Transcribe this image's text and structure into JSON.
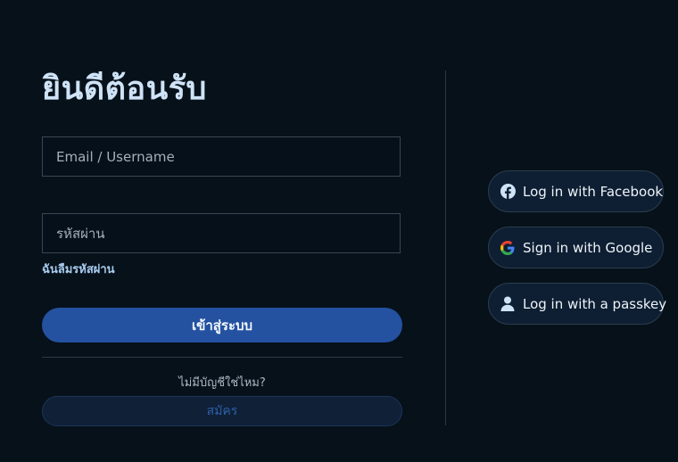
{
  "login": {
    "title": "ยินดีต้อนรับ",
    "email_placeholder": "Email / Username",
    "password_placeholder": "รหัสผ่าน",
    "forgot_password": "ฉันลืมรหัสผ่าน",
    "login_button": "เข้าสู่ระบบ",
    "no_account_text": "ไม่มีบัญชีใช่ไหม?",
    "signup_button": "สมัคร"
  },
  "social": {
    "facebook_label": "Log in with Facebook",
    "google_label": "Sign in with Google",
    "passkey_label": "Log in with a passkey",
    "facebook_icon": "facebook-icon",
    "google_icon": "google-icon",
    "passkey_icon": "user-icon"
  },
  "colors": {
    "background": "#07111a",
    "primary_button": "#2452a1",
    "title": "#cfe3f7",
    "link": "#a9cdf0"
  }
}
